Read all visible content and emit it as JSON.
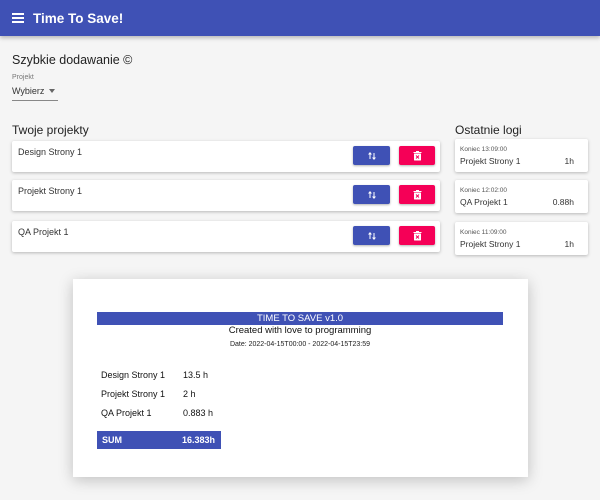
{
  "app": {
    "title": "Time To Save!"
  },
  "quick_add": {
    "title": "Szybkie dodawanie ©",
    "project_label": "Projekt",
    "select_value": "Wybierz"
  },
  "projects": {
    "title": "Twoje projekty",
    "items": [
      {
        "name": "Design Strony 1"
      },
      {
        "name": "Projekt Strony 1"
      },
      {
        "name": "QA Projekt 1"
      }
    ]
  },
  "logs": {
    "title": "Ostatnie logi",
    "items": [
      {
        "end": "Koniec 13:09:00",
        "project": "Projekt Strony 1",
        "hours": "1h"
      },
      {
        "end": "Koniec 12:02:00",
        "project": "QA Projekt 1",
        "hours": "0.88h"
      },
      {
        "end": "Koniec 11:09:00",
        "project": "Projekt Strony 1",
        "hours": "1h"
      }
    ]
  },
  "report": {
    "header": "TIME TO SAVE v1.0",
    "subtitle": "Created with love to programming",
    "date": "Date: 2022-04-15T00:00 - 2022-04-15T23:59",
    "rows": [
      {
        "name": "Design Strony 1",
        "value": "13.5 h"
      },
      {
        "name": "Projekt Strony 1",
        "value": "2 h"
      },
      {
        "name": "QA Projekt 1",
        "value": "0.883 h"
      }
    ],
    "sum_label": "SUM",
    "sum_value": "16.383h"
  },
  "colors": {
    "primary": "#3f51b5",
    "danger": "#f50057",
    "background": "#f5f5f5"
  },
  "icons": {
    "menu": "hamburger-icon",
    "swap": "swap-vertical-icon",
    "delete": "delete-icon"
  }
}
